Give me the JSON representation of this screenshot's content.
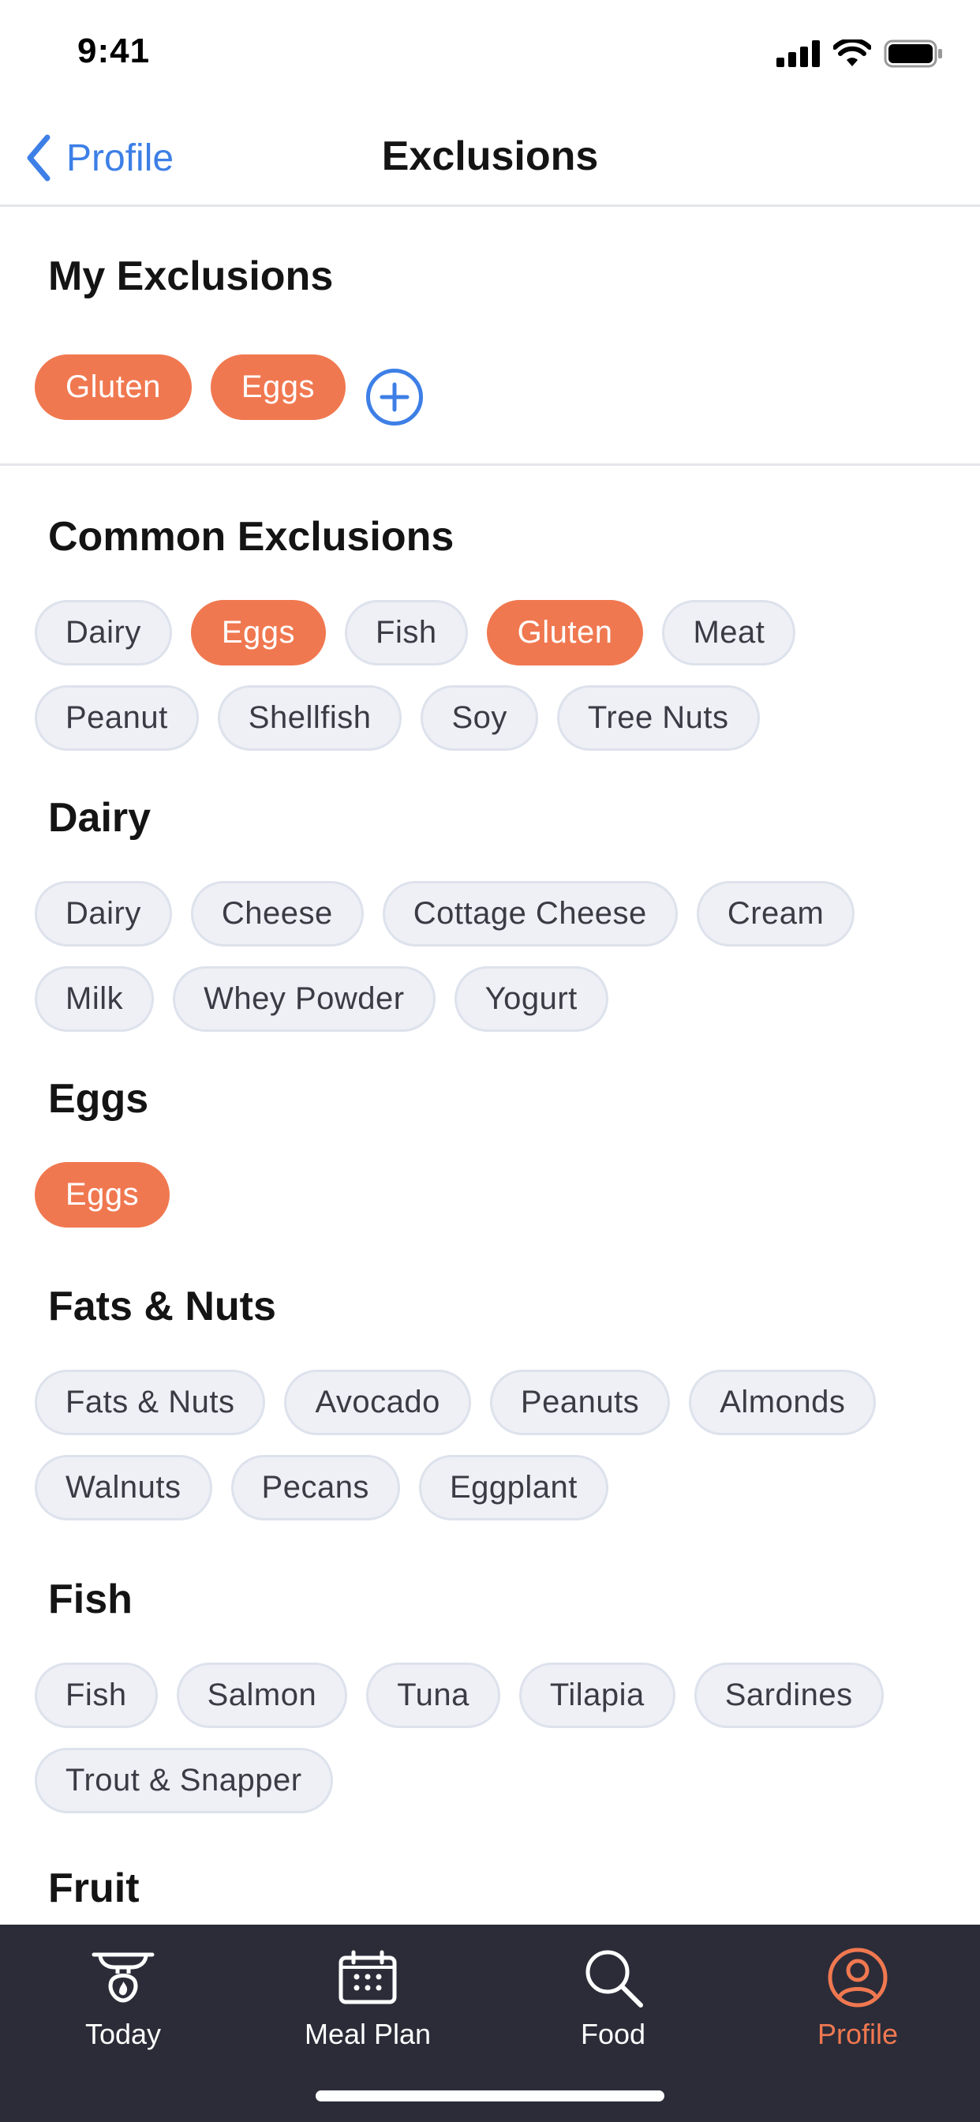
{
  "status_bar": {
    "time": "9:41"
  },
  "nav": {
    "back_label": "Profile",
    "title": "Exclusions"
  },
  "my_exclusions": {
    "title": "My Exclusions",
    "items": [
      "Gluten",
      "Eggs"
    ]
  },
  "sections": [
    {
      "title": "Common Exclusions",
      "chips": [
        {
          "label": "Dairy",
          "selected": false
        },
        {
          "label": "Eggs",
          "selected": true
        },
        {
          "label": "Fish",
          "selected": false
        },
        {
          "label": "Gluten",
          "selected": true
        },
        {
          "label": "Meat",
          "selected": false
        },
        {
          "label": "Peanut",
          "selected": false
        },
        {
          "label": "Shellfish",
          "selected": false
        },
        {
          "label": "Soy",
          "selected": false
        },
        {
          "label": "Tree Nuts",
          "selected": false
        }
      ]
    },
    {
      "title": "Dairy",
      "chips": [
        {
          "label": "Dairy",
          "selected": false
        },
        {
          "label": "Cheese",
          "selected": false
        },
        {
          "label": "Cottage Cheese",
          "selected": false
        },
        {
          "label": "Cream",
          "selected": false
        },
        {
          "label": "Milk",
          "selected": false
        },
        {
          "label": "Whey Powder",
          "selected": false
        },
        {
          "label": "Yogurt",
          "selected": false
        }
      ]
    },
    {
      "title": "Eggs",
      "chips": [
        {
          "label": "Eggs",
          "selected": true
        }
      ]
    },
    {
      "title": "Fats & Nuts",
      "chips": [
        {
          "label": "Fats & Nuts",
          "selected": false
        },
        {
          "label": "Avocado",
          "selected": false
        },
        {
          "label": "Peanuts",
          "selected": false
        },
        {
          "label": "Almonds",
          "selected": false
        },
        {
          "label": "Walnuts",
          "selected": false
        },
        {
          "label": "Pecans",
          "selected": false
        },
        {
          "label": "Eggplant",
          "selected": false
        }
      ]
    },
    {
      "title": "Fish",
      "chips": [
        {
          "label": "Fish",
          "selected": false
        },
        {
          "label": "Salmon",
          "selected": false
        },
        {
          "label": "Tuna",
          "selected": false
        },
        {
          "label": "Tilapia",
          "selected": false
        },
        {
          "label": "Sardines",
          "selected": false
        },
        {
          "label": "Trout & Snapper",
          "selected": false
        }
      ]
    },
    {
      "title": "Fruit",
      "chips": []
    }
  ],
  "tab_bar": {
    "tabs": [
      {
        "label": "Today",
        "icon": "kettlebell-icon",
        "active": false
      },
      {
        "label": "Meal Plan",
        "icon": "calendar-icon",
        "active": false
      },
      {
        "label": "Food",
        "icon": "search-icon",
        "active": false
      },
      {
        "label": "Profile",
        "icon": "profile-icon",
        "active": true
      }
    ]
  },
  "colors": {
    "accent": "#f07850",
    "link": "#3d7fe6",
    "chip_bg": "#eef0f5",
    "tab_bar_bg": "#2b2c38"
  }
}
